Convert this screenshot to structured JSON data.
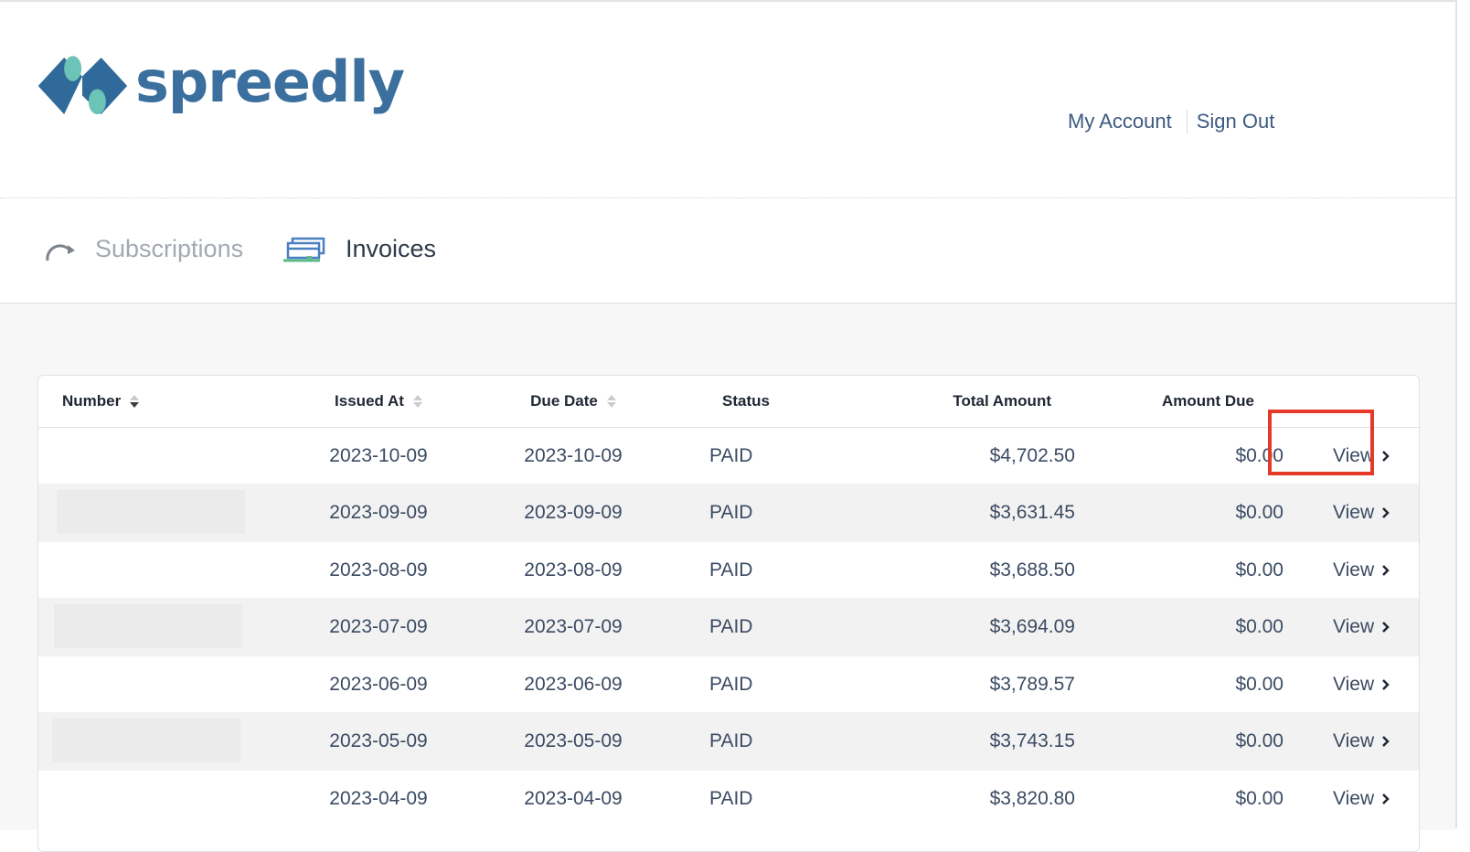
{
  "brand": {
    "name": "spreedly",
    "color": "#3b6f9e",
    "accent": "#6cc3b8"
  },
  "header": {
    "my_account": "My Account",
    "sign_out": "Sign Out"
  },
  "nav": {
    "tabs": [
      {
        "label": "Subscriptions",
        "active": false
      },
      {
        "label": "Invoices",
        "active": true
      }
    ]
  },
  "table": {
    "columns": [
      "Number",
      "Issued At",
      "Due Date",
      "Status",
      "Total Amount",
      "Amount Due"
    ],
    "view_label": "View",
    "rows": [
      {
        "issued_at": "2023-10-09",
        "due_date": "2023-10-09",
        "status": "PAID",
        "total": "$4,702.50",
        "amount_due": "$0.00"
      },
      {
        "issued_at": "2023-09-09",
        "due_date": "2023-09-09",
        "status": "PAID",
        "total": "$3,631.45",
        "amount_due": "$0.00"
      },
      {
        "issued_at": "2023-08-09",
        "due_date": "2023-08-09",
        "status": "PAID",
        "total": "$3,688.50",
        "amount_due": "$0.00"
      },
      {
        "issued_at": "2023-07-09",
        "due_date": "2023-07-09",
        "status": "PAID",
        "total": "$3,694.09",
        "amount_due": "$0.00"
      },
      {
        "issued_at": "2023-06-09",
        "due_date": "2023-06-09",
        "status": "PAID",
        "total": "$3,789.57",
        "amount_due": "$0.00"
      },
      {
        "issued_at": "2023-05-09",
        "due_date": "2023-05-09",
        "status": "PAID",
        "total": "$3,743.15",
        "amount_due": "$0.00"
      },
      {
        "issued_at": "2023-04-09",
        "due_date": "2023-04-09",
        "status": "PAID",
        "total": "$3,820.80",
        "amount_due": "$0.00"
      }
    ]
  },
  "highlight_color": "#e53a2a"
}
